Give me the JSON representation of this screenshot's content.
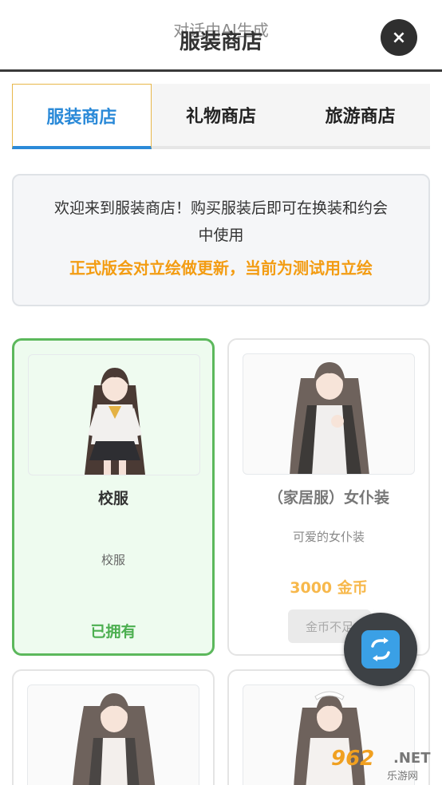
{
  "header": {
    "overlay_caption": "对话由AI生成",
    "title": "服装商店",
    "close_label": "×"
  },
  "tabs": [
    {
      "label": "服装商店",
      "active": true
    },
    {
      "label": "礼物商店",
      "active": false
    },
    {
      "label": "旅游商店",
      "active": false
    }
  ],
  "notice": {
    "line1": "欢迎来到服装商店！购买服装后即可在换装和约会",
    "line2": "中使用",
    "warning": "正式版会对立绘做更新，当前为测试用立绘"
  },
  "items": [
    {
      "name": "校服",
      "desc": "校服",
      "status": "已拥有"
    },
    {
      "name": "（家居服）女仆装",
      "desc": "可爱的女仆装",
      "price": "3000 金币",
      "button": "金币不足"
    },
    {
      "name": "",
      "desc": ""
    },
    {
      "name": "",
      "desc": ""
    }
  ],
  "fab": {
    "icon": "refresh-icon"
  },
  "watermark": {
    "top": "962",
    "net": ".NET",
    "bottom": "乐游网"
  },
  "colors": {
    "accent_blue": "#2b8ad8",
    "owned_green": "#4caf50",
    "price_gold": "#f7b84b",
    "warning_orange": "#f39c12"
  }
}
